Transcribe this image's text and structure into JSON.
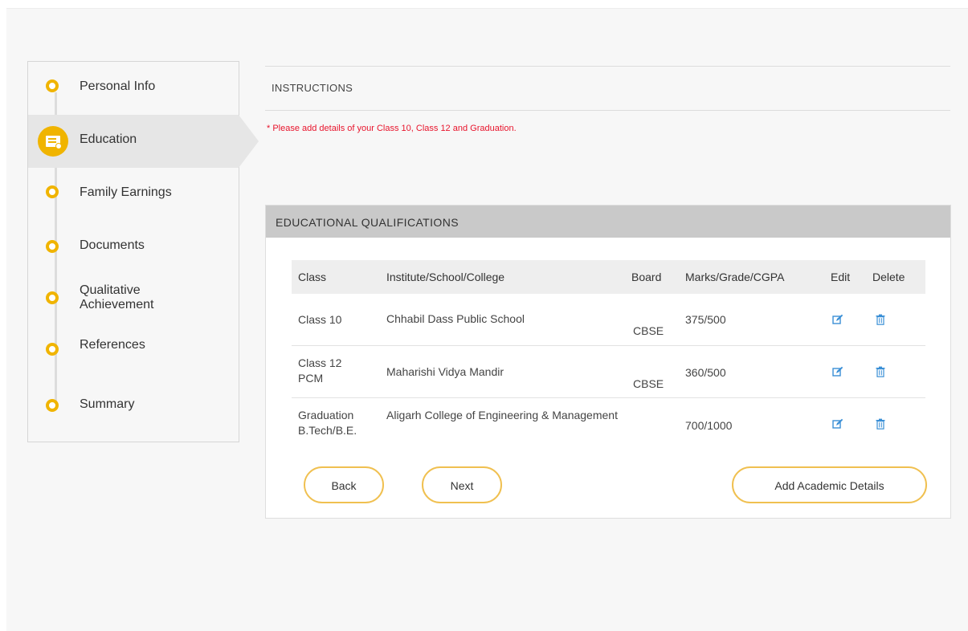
{
  "sidebar": {
    "steps": [
      {
        "label": "Personal Info"
      },
      {
        "label": "Education"
      },
      {
        "label": "Family Earnings"
      },
      {
        "label": "Documents"
      },
      {
        "label": "Qualitative Achievement"
      },
      {
        "label": "References"
      },
      {
        "label": "Summary"
      }
    ],
    "active_step": "Education",
    "accent_color": "#f0b400"
  },
  "instructions": {
    "heading": "INSTRUCTIONS",
    "note": "* Please add details of your Class 10, Class 12 and Graduation."
  },
  "qualifications": {
    "heading": "EDUCATIONAL QUALIFICATIONS",
    "columns": [
      "Class",
      "Institute/School/College",
      "Board",
      "Marks/Grade/CGPA",
      "Edit",
      "Delete"
    ],
    "rows": [
      {
        "class": "Class 10",
        "institute": "Chhabil Dass Public School",
        "board": "CBSE",
        "marks": "375/500"
      },
      {
        "class": "Class 12 PCM",
        "institute": "Maharishi Vidya Mandir",
        "board": "CBSE",
        "marks": "360/500"
      },
      {
        "class": "Graduation B.Tech/B.E.",
        "institute": "Aligarh College of Engineering & Management",
        "board": "",
        "marks": "700/1000"
      }
    ],
    "edit_icon": "edit-icon",
    "delete_icon": "trash-icon",
    "icon_color": "#3a8fd6"
  },
  "actions": {
    "back_label": "Back",
    "next_label": "Next",
    "add_label": "Add Academic Details"
  }
}
